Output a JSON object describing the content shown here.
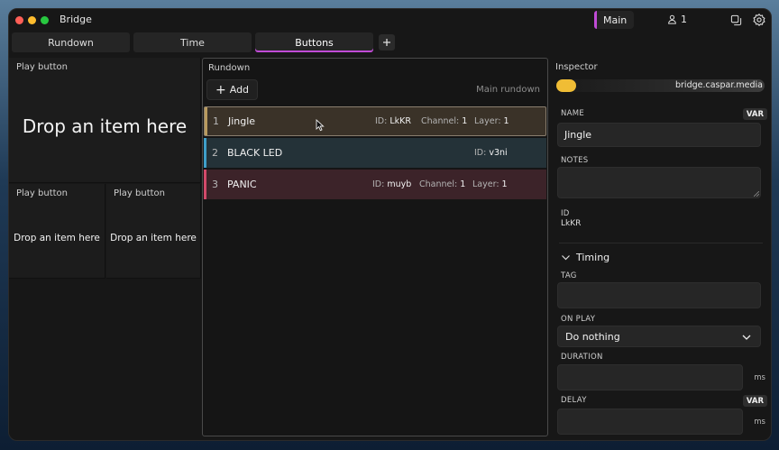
{
  "app": {
    "title": "Bridge"
  },
  "header": {
    "workspace": "Main",
    "user_count": "1"
  },
  "tabs": [
    {
      "label": "Rundown",
      "active": false
    },
    {
      "label": "Time",
      "active": false
    },
    {
      "label": "Buttons",
      "active": true
    }
  ],
  "buttons_grid": {
    "large": {
      "label": "Play button",
      "placeholder": "Drop an item here"
    },
    "small": [
      {
        "label": "Play button",
        "placeholder": "Drop an item here"
      },
      {
        "label": "Play button",
        "placeholder": "Drop an item here"
      }
    ]
  },
  "rundown": {
    "label": "Rundown",
    "add_label": "Add",
    "name": "Main rundown",
    "items": [
      {
        "num": "1",
        "name": "Jingle",
        "id_label": "ID:",
        "id": "LkKR",
        "channel_label": "Channel:",
        "channel": "1",
        "layer_label": "Layer:",
        "layer": "1",
        "color": "#b89a5e"
      },
      {
        "num": "2",
        "name": "BLACK LED",
        "id_label": "ID:",
        "id": "v3ni",
        "color": "#3f9fc9"
      },
      {
        "num": "3",
        "name": "PANIC",
        "id_label": "ID:",
        "id": "muyb",
        "channel_label": "Channel:",
        "channel": "1",
        "layer_label": "Layer:",
        "layer": "1",
        "color": "#d24a6a"
      }
    ]
  },
  "inspector": {
    "label": "Inspector",
    "server": "bridge.caspar.media",
    "name_label": "NAME",
    "var_label": "VAR",
    "name_value": "Jingle",
    "notes_label": "NOTES",
    "id_label": "ID",
    "id_value": "LkKR",
    "timing_label": "Timing",
    "tag_label": "TAG",
    "on_play_label": "ON PLAY",
    "on_play_value": "Do nothing",
    "duration_label": "DURATION",
    "duration_unit": "ms",
    "delay_label": "DELAY",
    "delay_unit": "ms"
  },
  "colors": {
    "accent": "#c04bd6",
    "status": "#f0bd35"
  }
}
